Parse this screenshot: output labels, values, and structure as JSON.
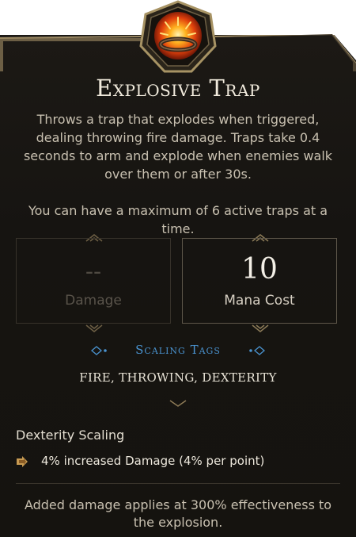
{
  "skill": {
    "name": "Explosive Trap",
    "icon": "explosive-trap-icon",
    "description": "Throws a trap that explodes when triggered, dealing throwing fire damage. Traps take 0.4 seconds to arm and explode when enemies walk over them or after 30s.",
    "max_traps_note": "You can have a maximum of 6 active traps at a time."
  },
  "stats": {
    "damage": {
      "value": "--",
      "label": "Damage"
    },
    "mana_cost": {
      "value": "10",
      "label": "Mana Cost"
    }
  },
  "scaling": {
    "header": "Scaling Tags",
    "tags": "FIRE, THROWING, DEXTERITY"
  },
  "dexterity_scaling": {
    "title": "Dexterity Scaling",
    "bullet_icon": "arrow-bullet-icon",
    "bonus": "4% increased Damage (4% per point)"
  },
  "footer_note": "Added damage applies at 300% effectiveness to the explosion.",
  "colors": {
    "panel_bg": "#1a1713",
    "frame_gold": "#8f7c57",
    "scaling_blue": "#4a93cf",
    "title": "#f1ebdd"
  }
}
